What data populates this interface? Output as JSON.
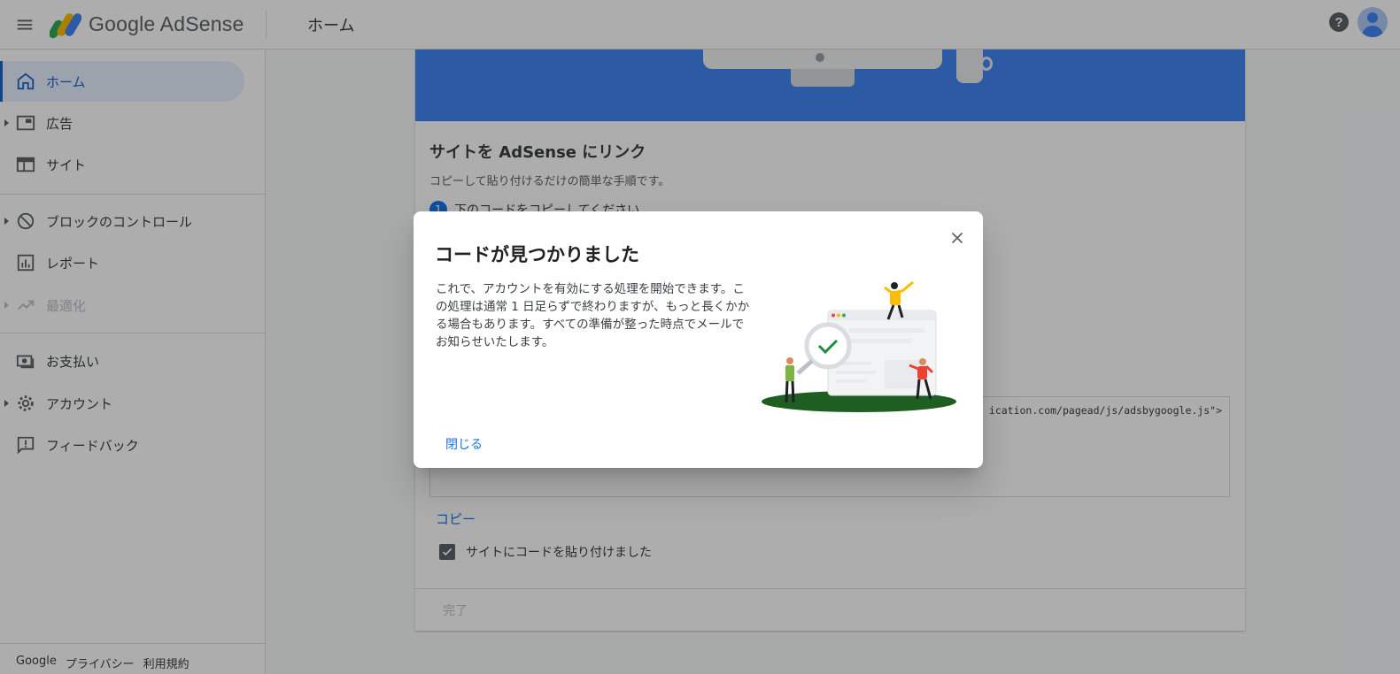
{
  "header": {
    "logo_text": "Google AdSense",
    "page_title": "ホーム",
    "help_icon": "help-circle-icon",
    "avatar_icon": "account-circle-icon"
  },
  "sidebar": {
    "items": [
      {
        "label": "ホーム",
        "icon": "home-icon",
        "active": true
      },
      {
        "label": "広告",
        "icon": "ads-icon",
        "expandable": true
      },
      {
        "label": "サイト",
        "icon": "sites-icon"
      },
      {
        "label": "ブロックのコントロール",
        "icon": "block-icon",
        "expandable": true
      },
      {
        "label": "レポート",
        "icon": "reports-icon"
      },
      {
        "label": "最適化",
        "icon": "trending-up-icon",
        "expandable": true,
        "disabled": true
      },
      {
        "label": "お支払い",
        "icon": "payments-icon"
      },
      {
        "label": "アカウント",
        "icon": "gear-icon",
        "expandable": true
      },
      {
        "label": "フィードバック",
        "icon": "feedback-icon"
      }
    ],
    "footer": {
      "google": "Google",
      "privacy": "プライバシー",
      "terms": "利用規約"
    }
  },
  "card": {
    "title": "サイトを AdSense にリンク",
    "subtitle": "コピーして貼り付けるだけの簡単な手順です。",
    "step_number": "1",
    "step_label": "下のコードをコピーしてください",
    "code_snippet": "ication.com/pagead/js/adsbygoogle.js\">",
    "copy_label": "コピー",
    "checkbox_label": "サイトにコードを貼り付けました",
    "checkbox_checked": true,
    "done_label": "完了"
  },
  "dialog": {
    "title": "コードが見つかりました",
    "body": "これで、アカウントを有効にする処理を開始できます。この処理は通常 1 日足らずで終わりますが、もっと長くかかる場合もあります。すべての準備が整った時点でメールでお知らせいたします。",
    "close_label": "閉じる",
    "close_icon": "close-icon"
  },
  "colors": {
    "brand_blue": "#1a73e8",
    "banner_blue": "#4285f4",
    "active_bg": "#e8f0fe"
  }
}
